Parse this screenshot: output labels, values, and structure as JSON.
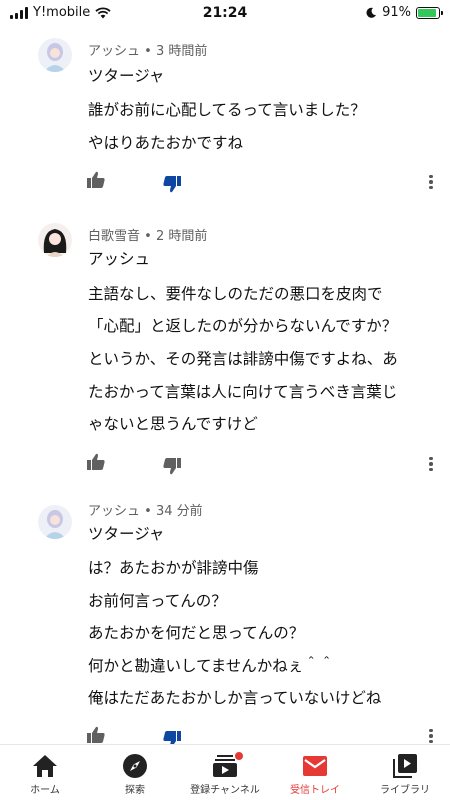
{
  "status_bar": {
    "carrier": "Y!mobile",
    "time": "21:24",
    "battery": "91%",
    "battery_level": 0.91
  },
  "comments": [
    {
      "author": "アッシュ",
      "time": "3 時間前",
      "lines": [
        "ツタージャ",
        "誰がお前に心配してるって言いました？",
        "やはりあたおかですね"
      ],
      "disliked": true
    },
    {
      "author": "白歌雪音",
      "time": "2 時間前",
      "lines": [
        "アッシュ",
        "主語なし、要件なしのただの悪口を皮肉で",
        "「心配」と返したのが分からないんですか？",
        "というか、その発言は誹謗中傷ですよね、あ",
        "たおかって言葉は人に向けて言うべき言葉じ",
        "ゃないと思うんですけど"
      ],
      "disliked": false
    },
    {
      "author": "アッシュ",
      "time": "34 分前",
      "lines": [
        "ツタージャ",
        "は？あたおかが誹謗中傷",
        "お前何言ってんの？",
        "あたおかを何だと思ってんの？",
        "何かと勘違いしてませんかねぇ＾＾",
        "俺はただあたおかしか言っていないけどね"
      ],
      "disliked": true
    }
  ],
  "meta_separator": " • ",
  "bottom_nav": [
    {
      "label": "ホーム",
      "icon": "home-icon"
    },
    {
      "label": "探索",
      "icon": "compass-icon"
    },
    {
      "label": "登録チャンネル",
      "icon": "subscriptions-icon"
    },
    {
      "label": "受信トレイ",
      "icon": "inbox-icon",
      "active": true
    },
    {
      "label": "ライブラリ",
      "icon": "library-icon"
    }
  ],
  "colors": {
    "accent_red": "#e53935",
    "dislike_blue": "#0d47a1",
    "battery_green": "#34c759",
    "meta_gray": "#606060"
  }
}
